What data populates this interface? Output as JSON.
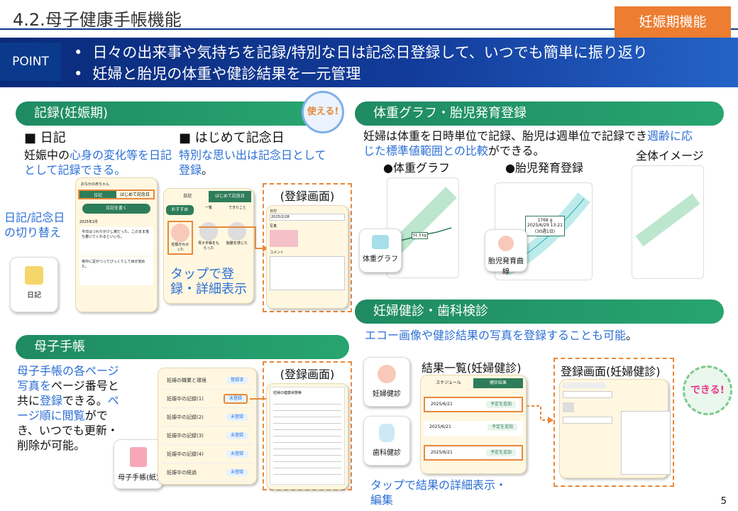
{
  "header": {
    "title": "4.2.母子健康手帳機能",
    "badge": "妊娠期機能"
  },
  "point": {
    "tag": "POINT",
    "items": [
      "日々の出来事や気持ちを記録/特別な日は記念日登録して、いつでも簡単に振り返り",
      "妊婦と胎児の体重や健診結果を一元管理"
    ]
  },
  "record": {
    "title": "記録(妊娠期)",
    "sticker": "使える!",
    "diary": {
      "head": "■ 日記",
      "desc_pre": "妊娠中の",
      "desc_blue": "心身の変化等を日記として記録できる。",
      "icon_label": "日記"
    },
    "anniv": {
      "head": "■ はじめて記念日",
      "desc_blue": "特別な思い出は記念日として登録",
      "desc_post": "。"
    },
    "switch_note": "日記/記念日の切り替え",
    "tap_note": "タップで登録・詳細表示",
    "reg_label": "(登録画面)",
    "phone_diary": {
      "name": "おなかの赤ちゃん",
      "tab1": "日記",
      "tab2": "はじめて記念日",
      "btn": "日記を書く",
      "month": "2025年2月",
      "entry1": "今日はつわりが少し楽だった。このまま落ち着いてくれるといいな。",
      "entry2": "夜中に足がつってびっくりして目が覚めた。"
    },
    "phone_anniv": {
      "tab1": "日記",
      "tab2": "はじめて記念日",
      "sub1": "おすすめ",
      "sub2": "一覧",
      "sub3": "できたこと",
      "c1": "妊娠がわかった",
      "c2": "母子手帳をもらった",
      "c3": "胎動を感じた"
    },
    "form": {
      "date_label": "日付",
      "date": "2025/2/28",
      "photo_label": "写真",
      "comment_label": "コメント"
    }
  },
  "weight": {
    "title": "体重グラフ・胎児発育登録",
    "desc_pre": "妊婦は体重を日時単位で記録、胎児は週単位で記録でき",
    "desc_blue": "週齢に応じた標準値範囲との比較",
    "desc_post": "ができる。",
    "graph_label": "●体重グラフ",
    "fetal_label": "●胎児発育登録",
    "overall_label": "全体イメージ",
    "weight_icon": "体重グラフ",
    "fetal_icon": "胎児発育曲線",
    "weight_val": "51.3 kg",
    "fetal_val": "1769 g",
    "fetal_date": "2025/6/29 13:21",
    "fetal_week": "(30週1日)"
  },
  "checkup": {
    "title": "妊婦健診・歯科検診",
    "desc": "エコー画像や健診結果の写真を登録することも可能",
    "desc_post": "。",
    "list_label": "結果一覧(妊婦健診)",
    "reg_label": "登録画面(妊婦健診)",
    "sticker": "できる!",
    "icon1": "妊婦健診",
    "icon2": "歯科健診",
    "tab1": "スケジュール",
    "tab2": "健診結果",
    "rows": [
      "2025/6/21",
      "2025/6/21",
      "2025/6/21"
    ],
    "row_btn": "予定を追加",
    "tap_note": "タップで結果の詳細表示・編集"
  },
  "techo": {
    "title": "母子手帳",
    "desc_blue1": "母子手帳の各ページ写真を",
    "desc1": "ページ番号と共に",
    "desc_blue2": "登録",
    "desc2": "できる。",
    "desc_blue3": "ページ順に閲覧",
    "desc3": "ができ、いつでも更新・削除が可能。",
    "icon_label": "母子手帳(紙)",
    "reg_label": "(登録画面)",
    "rows": [
      "妊婦の職業と環境",
      "妊娠中の記録(1)",
      "妊娠中の記録(2)",
      "妊娠中の記録(3)",
      "妊娠中の記録(4)",
      "妊娠中の経過"
    ],
    "row_btn": [
      "登録済",
      "未登録",
      "未登録",
      "未登録",
      "未登録",
      "未登録"
    ],
    "doc_title": "妊婦の健康状態等"
  },
  "page_number": "5"
}
